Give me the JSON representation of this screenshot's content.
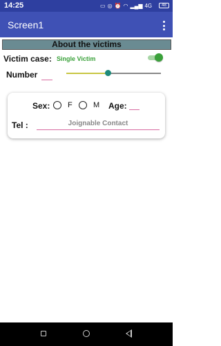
{
  "status_bar": {
    "time": "14:25",
    "network": "4G",
    "battery": "48"
  },
  "app_bar": {
    "title": "Screen1"
  },
  "section": {
    "title": "About the victims"
  },
  "victim_case": {
    "label": "Victim case:",
    "value": "Single Victim",
    "toggle_on": true
  },
  "number": {
    "label": "Number",
    "value": "",
    "slider_fraction": 0.44
  },
  "card": {
    "sex_label": "Sex:",
    "option_f": "F",
    "option_m": "M",
    "age_label": "Age:",
    "age_value": "",
    "tel_label": "Tel :",
    "tel_placeholder": "Joignable Contact"
  },
  "colors": {
    "status_bar": "#2e3fa0",
    "app_bar": "#3f51b5",
    "section_header": "#6a8b92",
    "accent_green": "#3aa13a",
    "input_underline": "#d76aa0"
  }
}
